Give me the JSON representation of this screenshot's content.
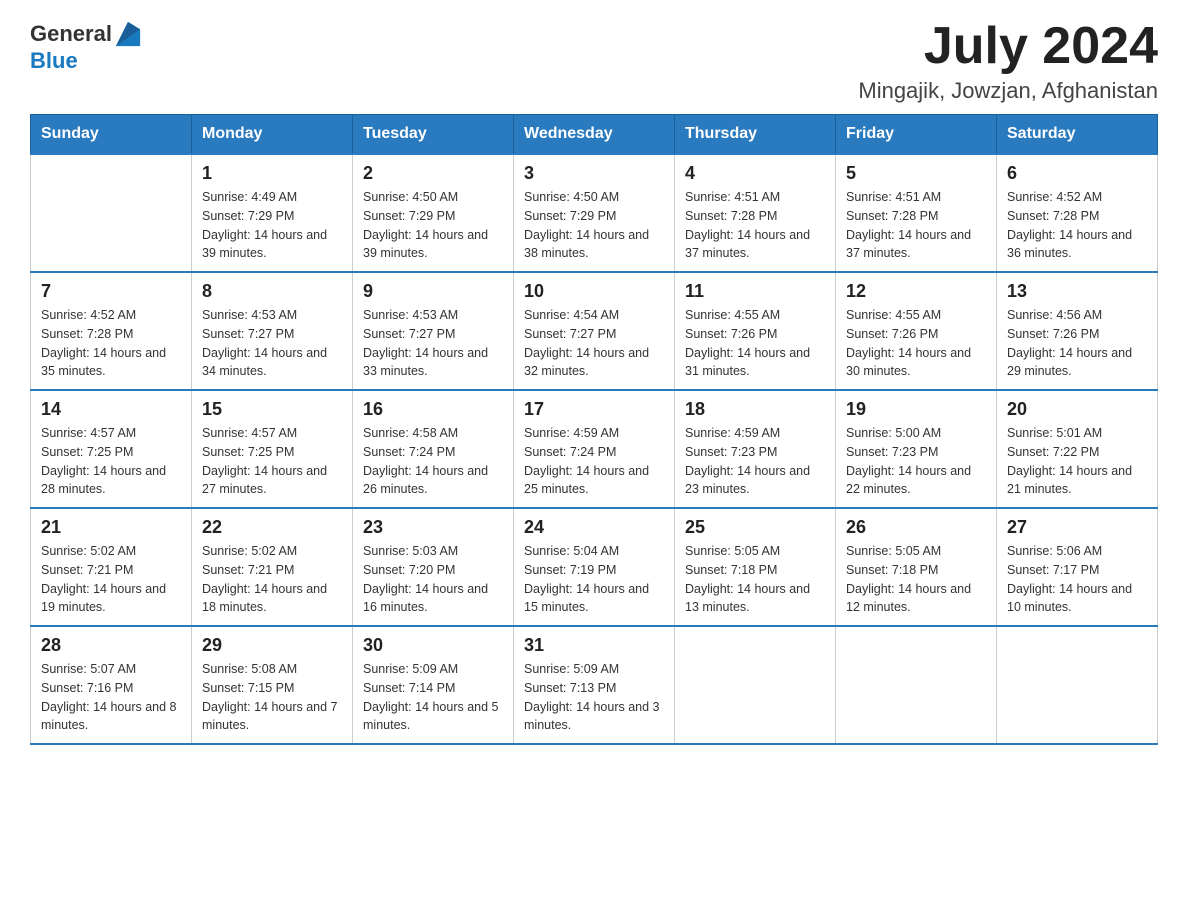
{
  "header": {
    "logo": {
      "text_general": "General",
      "text_blue": "Blue"
    },
    "month_year": "July 2024",
    "location": "Mingajik, Jowzjan, Afghanistan"
  },
  "columns": [
    "Sunday",
    "Monday",
    "Tuesday",
    "Wednesday",
    "Thursday",
    "Friday",
    "Saturday"
  ],
  "weeks": [
    [
      {
        "day": "",
        "sunrise": "",
        "sunset": "",
        "daylight": ""
      },
      {
        "day": "1",
        "sunrise": "Sunrise: 4:49 AM",
        "sunset": "Sunset: 7:29 PM",
        "daylight": "Daylight: 14 hours and 39 minutes."
      },
      {
        "day": "2",
        "sunrise": "Sunrise: 4:50 AM",
        "sunset": "Sunset: 7:29 PM",
        "daylight": "Daylight: 14 hours and 39 minutes."
      },
      {
        "day": "3",
        "sunrise": "Sunrise: 4:50 AM",
        "sunset": "Sunset: 7:29 PM",
        "daylight": "Daylight: 14 hours and 38 minutes."
      },
      {
        "day": "4",
        "sunrise": "Sunrise: 4:51 AM",
        "sunset": "Sunset: 7:28 PM",
        "daylight": "Daylight: 14 hours and 37 minutes."
      },
      {
        "day": "5",
        "sunrise": "Sunrise: 4:51 AM",
        "sunset": "Sunset: 7:28 PM",
        "daylight": "Daylight: 14 hours and 37 minutes."
      },
      {
        "day": "6",
        "sunrise": "Sunrise: 4:52 AM",
        "sunset": "Sunset: 7:28 PM",
        "daylight": "Daylight: 14 hours and 36 minutes."
      }
    ],
    [
      {
        "day": "7",
        "sunrise": "Sunrise: 4:52 AM",
        "sunset": "Sunset: 7:28 PM",
        "daylight": "Daylight: 14 hours and 35 minutes."
      },
      {
        "day": "8",
        "sunrise": "Sunrise: 4:53 AM",
        "sunset": "Sunset: 7:27 PM",
        "daylight": "Daylight: 14 hours and 34 minutes."
      },
      {
        "day": "9",
        "sunrise": "Sunrise: 4:53 AM",
        "sunset": "Sunset: 7:27 PM",
        "daylight": "Daylight: 14 hours and 33 minutes."
      },
      {
        "day": "10",
        "sunrise": "Sunrise: 4:54 AM",
        "sunset": "Sunset: 7:27 PM",
        "daylight": "Daylight: 14 hours and 32 minutes."
      },
      {
        "day": "11",
        "sunrise": "Sunrise: 4:55 AM",
        "sunset": "Sunset: 7:26 PM",
        "daylight": "Daylight: 14 hours and 31 minutes."
      },
      {
        "day": "12",
        "sunrise": "Sunrise: 4:55 AM",
        "sunset": "Sunset: 7:26 PM",
        "daylight": "Daylight: 14 hours and 30 minutes."
      },
      {
        "day": "13",
        "sunrise": "Sunrise: 4:56 AM",
        "sunset": "Sunset: 7:26 PM",
        "daylight": "Daylight: 14 hours and 29 minutes."
      }
    ],
    [
      {
        "day": "14",
        "sunrise": "Sunrise: 4:57 AM",
        "sunset": "Sunset: 7:25 PM",
        "daylight": "Daylight: 14 hours and 28 minutes."
      },
      {
        "day": "15",
        "sunrise": "Sunrise: 4:57 AM",
        "sunset": "Sunset: 7:25 PM",
        "daylight": "Daylight: 14 hours and 27 minutes."
      },
      {
        "day": "16",
        "sunrise": "Sunrise: 4:58 AM",
        "sunset": "Sunset: 7:24 PM",
        "daylight": "Daylight: 14 hours and 26 minutes."
      },
      {
        "day": "17",
        "sunrise": "Sunrise: 4:59 AM",
        "sunset": "Sunset: 7:24 PM",
        "daylight": "Daylight: 14 hours and 25 minutes."
      },
      {
        "day": "18",
        "sunrise": "Sunrise: 4:59 AM",
        "sunset": "Sunset: 7:23 PM",
        "daylight": "Daylight: 14 hours and 23 minutes."
      },
      {
        "day": "19",
        "sunrise": "Sunrise: 5:00 AM",
        "sunset": "Sunset: 7:23 PM",
        "daylight": "Daylight: 14 hours and 22 minutes."
      },
      {
        "day": "20",
        "sunrise": "Sunrise: 5:01 AM",
        "sunset": "Sunset: 7:22 PM",
        "daylight": "Daylight: 14 hours and 21 minutes."
      }
    ],
    [
      {
        "day": "21",
        "sunrise": "Sunrise: 5:02 AM",
        "sunset": "Sunset: 7:21 PM",
        "daylight": "Daylight: 14 hours and 19 minutes."
      },
      {
        "day": "22",
        "sunrise": "Sunrise: 5:02 AM",
        "sunset": "Sunset: 7:21 PM",
        "daylight": "Daylight: 14 hours and 18 minutes."
      },
      {
        "day": "23",
        "sunrise": "Sunrise: 5:03 AM",
        "sunset": "Sunset: 7:20 PM",
        "daylight": "Daylight: 14 hours and 16 minutes."
      },
      {
        "day": "24",
        "sunrise": "Sunrise: 5:04 AM",
        "sunset": "Sunset: 7:19 PM",
        "daylight": "Daylight: 14 hours and 15 minutes."
      },
      {
        "day": "25",
        "sunrise": "Sunrise: 5:05 AM",
        "sunset": "Sunset: 7:18 PM",
        "daylight": "Daylight: 14 hours and 13 minutes."
      },
      {
        "day": "26",
        "sunrise": "Sunrise: 5:05 AM",
        "sunset": "Sunset: 7:18 PM",
        "daylight": "Daylight: 14 hours and 12 minutes."
      },
      {
        "day": "27",
        "sunrise": "Sunrise: 5:06 AM",
        "sunset": "Sunset: 7:17 PM",
        "daylight": "Daylight: 14 hours and 10 minutes."
      }
    ],
    [
      {
        "day": "28",
        "sunrise": "Sunrise: 5:07 AM",
        "sunset": "Sunset: 7:16 PM",
        "daylight": "Daylight: 14 hours and 8 minutes."
      },
      {
        "day": "29",
        "sunrise": "Sunrise: 5:08 AM",
        "sunset": "Sunset: 7:15 PM",
        "daylight": "Daylight: 14 hours and 7 minutes."
      },
      {
        "day": "30",
        "sunrise": "Sunrise: 5:09 AM",
        "sunset": "Sunset: 7:14 PM",
        "daylight": "Daylight: 14 hours and 5 minutes."
      },
      {
        "day": "31",
        "sunrise": "Sunrise: 5:09 AM",
        "sunset": "Sunset: 7:13 PM",
        "daylight": "Daylight: 14 hours and 3 minutes."
      },
      {
        "day": "",
        "sunrise": "",
        "sunset": "",
        "daylight": ""
      },
      {
        "day": "",
        "sunrise": "",
        "sunset": "",
        "daylight": ""
      },
      {
        "day": "",
        "sunrise": "",
        "sunset": "",
        "daylight": ""
      }
    ]
  ]
}
